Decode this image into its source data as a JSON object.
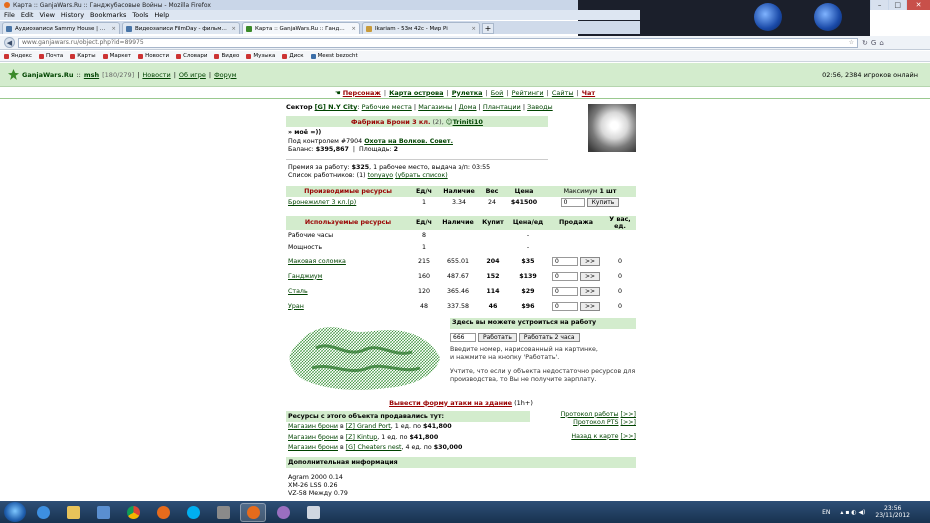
{
  "window": {
    "title": "Карта :: GanjaWars.Ru :: Ганджубасовые Войны - Mozilla Firefox"
  },
  "menubar": [
    "File",
    "Edit",
    "View",
    "History",
    "Bookmarks",
    "Tools",
    "Help"
  ],
  "tabs": [
    {
      "label": "Аудиозаписи Sammy House | 2 ауди...",
      "color": "#4a76a8"
    },
    {
      "label": "Видеозаписи FilmDay - фильмы и м...",
      "color": "#4a76a8"
    },
    {
      "label": "Карта :: GanjaWars.Ru :: Ганджубасо...",
      "color": "#3b8a2a",
      "active": true
    },
    {
      "label": "Ikariam - 53м 42с - Мир Pi",
      "color": "#c89b3c"
    }
  ],
  "url": "www.ganjawars.ru/object.php?id=89975",
  "bookmarks": [
    "Яндекс",
    "Почта",
    "Карты",
    "Маркет",
    "Новости",
    "Словари",
    "Видео",
    "Музыка",
    "Диск",
    "Meest bezocht"
  ],
  "gw": {
    "site": "GanjaWars.Ru",
    "user": "msh",
    "hp": "[180/279]",
    "news": "Новости",
    "about": "Об игре",
    "forum": "Форум",
    "status": "02:56, 2384 игроков онлайн",
    "menu": [
      "Персонаж",
      "Карта острова",
      "Рулетка",
      "Бой",
      "Рейтинги",
      "Сайты",
      "Чат"
    ]
  },
  "obj": {
    "sector_label": "Сектор",
    "sector": "[G] N.Y City",
    "sector_links": [
      "Рабочие места",
      "Магазины",
      "Дома",
      "Плантации",
      "Заводы"
    ],
    "title": "Фабрика Брони 3 кл.",
    "count": "(2),",
    "owner": "Triniti10",
    "moe": "» моё =))",
    "control_prefix": "Под контролем #7904",
    "control_link": "Охота на Волков. Совет.",
    "balance_label": "Баланс:",
    "balance": "$395,867",
    "area_label": "Площадь:",
    "area": "2",
    "premium_text": "Премия за работу:",
    "premium": "$325",
    "premium_rest": ", 1 рабочее место, выдача з/п: 03:55",
    "workers_prefix": "Список работников: (1)",
    "worker": "tonyayo",
    "remove": "(убрать список)"
  },
  "produced": {
    "headers": [
      "Производимые ресурсы",
      "Ед/ч",
      "Наличие",
      "Вес",
      "Цена",
      "Максимум"
    ],
    "max": "1 шт",
    "row": {
      "name": "Бронежилет 3 кл.(р)",
      "rate": "1",
      "stock": "3.34",
      "weight": "24",
      "price": "$41500",
      "qty": "0",
      "buy": "Купить"
    }
  },
  "used": {
    "headers": [
      "Используемые ресурсы",
      "Ед/ч",
      "Наличие",
      "Купит",
      "Цена/ед",
      "Продажа",
      "У вас, ед."
    ],
    "rows": [
      {
        "name": "Рабочие часы",
        "rate": "8",
        "stock": "",
        "buy": "",
        "price": "-",
        "link": false
      },
      {
        "name": "Мощность",
        "rate": "1",
        "stock": "",
        "buy": "",
        "price": "-",
        "link": false
      },
      {
        "name": "Маковая соломка",
        "rate": "215",
        "stock": "655.01",
        "buy": "204",
        "price": "$35",
        "qty": "0",
        "have": "0",
        "link": true
      },
      {
        "name": "Ганджиум",
        "rate": "160",
        "stock": "487.67",
        "buy": "152",
        "price": "$139",
        "qty": "0",
        "have": "0",
        "link": true
      },
      {
        "name": "Сталь",
        "rate": "120",
        "stock": "365.46",
        "buy": "114",
        "price": "$29",
        "qty": "0",
        "have": "0",
        "link": true
      },
      {
        "name": "Уран",
        "rate": "48",
        "stock": "337.58",
        "buy": "46",
        "price": "$96",
        "qty": "0",
        "have": "0",
        "link": true
      }
    ],
    "sell_btn": ">>"
  },
  "work": {
    "header": "Здесь вы можете устроиться на работу",
    "code": "666",
    "btn1": "Работать",
    "btn2": "Работать 2 часа",
    "hint1": "Введите номер, нарисованный на картинке,",
    "hint2": "и нажмите на кнопку 'Работать'.",
    "note": "Учтите, что если у объекта недостаточно ресурсов для производства, то Вы не получите зарплату."
  },
  "attack": {
    "link": "Вывести форму атаки на здание",
    "hours": "(1h+)"
  },
  "sellers": {
    "header": "Ресурсы с этого объекта продавались тут:",
    "items": [
      {
        "shop": "Магазин брони",
        "in": "в",
        "loc": "[Z] Grand Port",
        "rest": ", 1 ед. по",
        "price": "$41,800"
      },
      {
        "shop": "Магазин брони",
        "in": "в",
        "loc": "[Z] Kintup",
        "rest": ", 1 ед. по",
        "price": "$41,800"
      },
      {
        "shop": "Магазин брони",
        "in": "в",
        "loc": "[G] Cheaters nest",
        "rest": ", 4 ед. по",
        "price": "$30,000"
      }
    ],
    "protocol_work": "Протокол работы",
    "protocol_pts": "Протокол PTS",
    "back": "Назад к карте",
    "arrows": "[>>]"
  },
  "extra": {
    "header": "Дополнительная информация",
    "items": [
      "Agram 2000 0.14",
      "XM-26 LSS 0.26",
      "VZ-58 Между 0.79"
    ]
  },
  "taskbar": {
    "lang": "EN",
    "time": "23:56",
    "date": "23/11/2012"
  }
}
